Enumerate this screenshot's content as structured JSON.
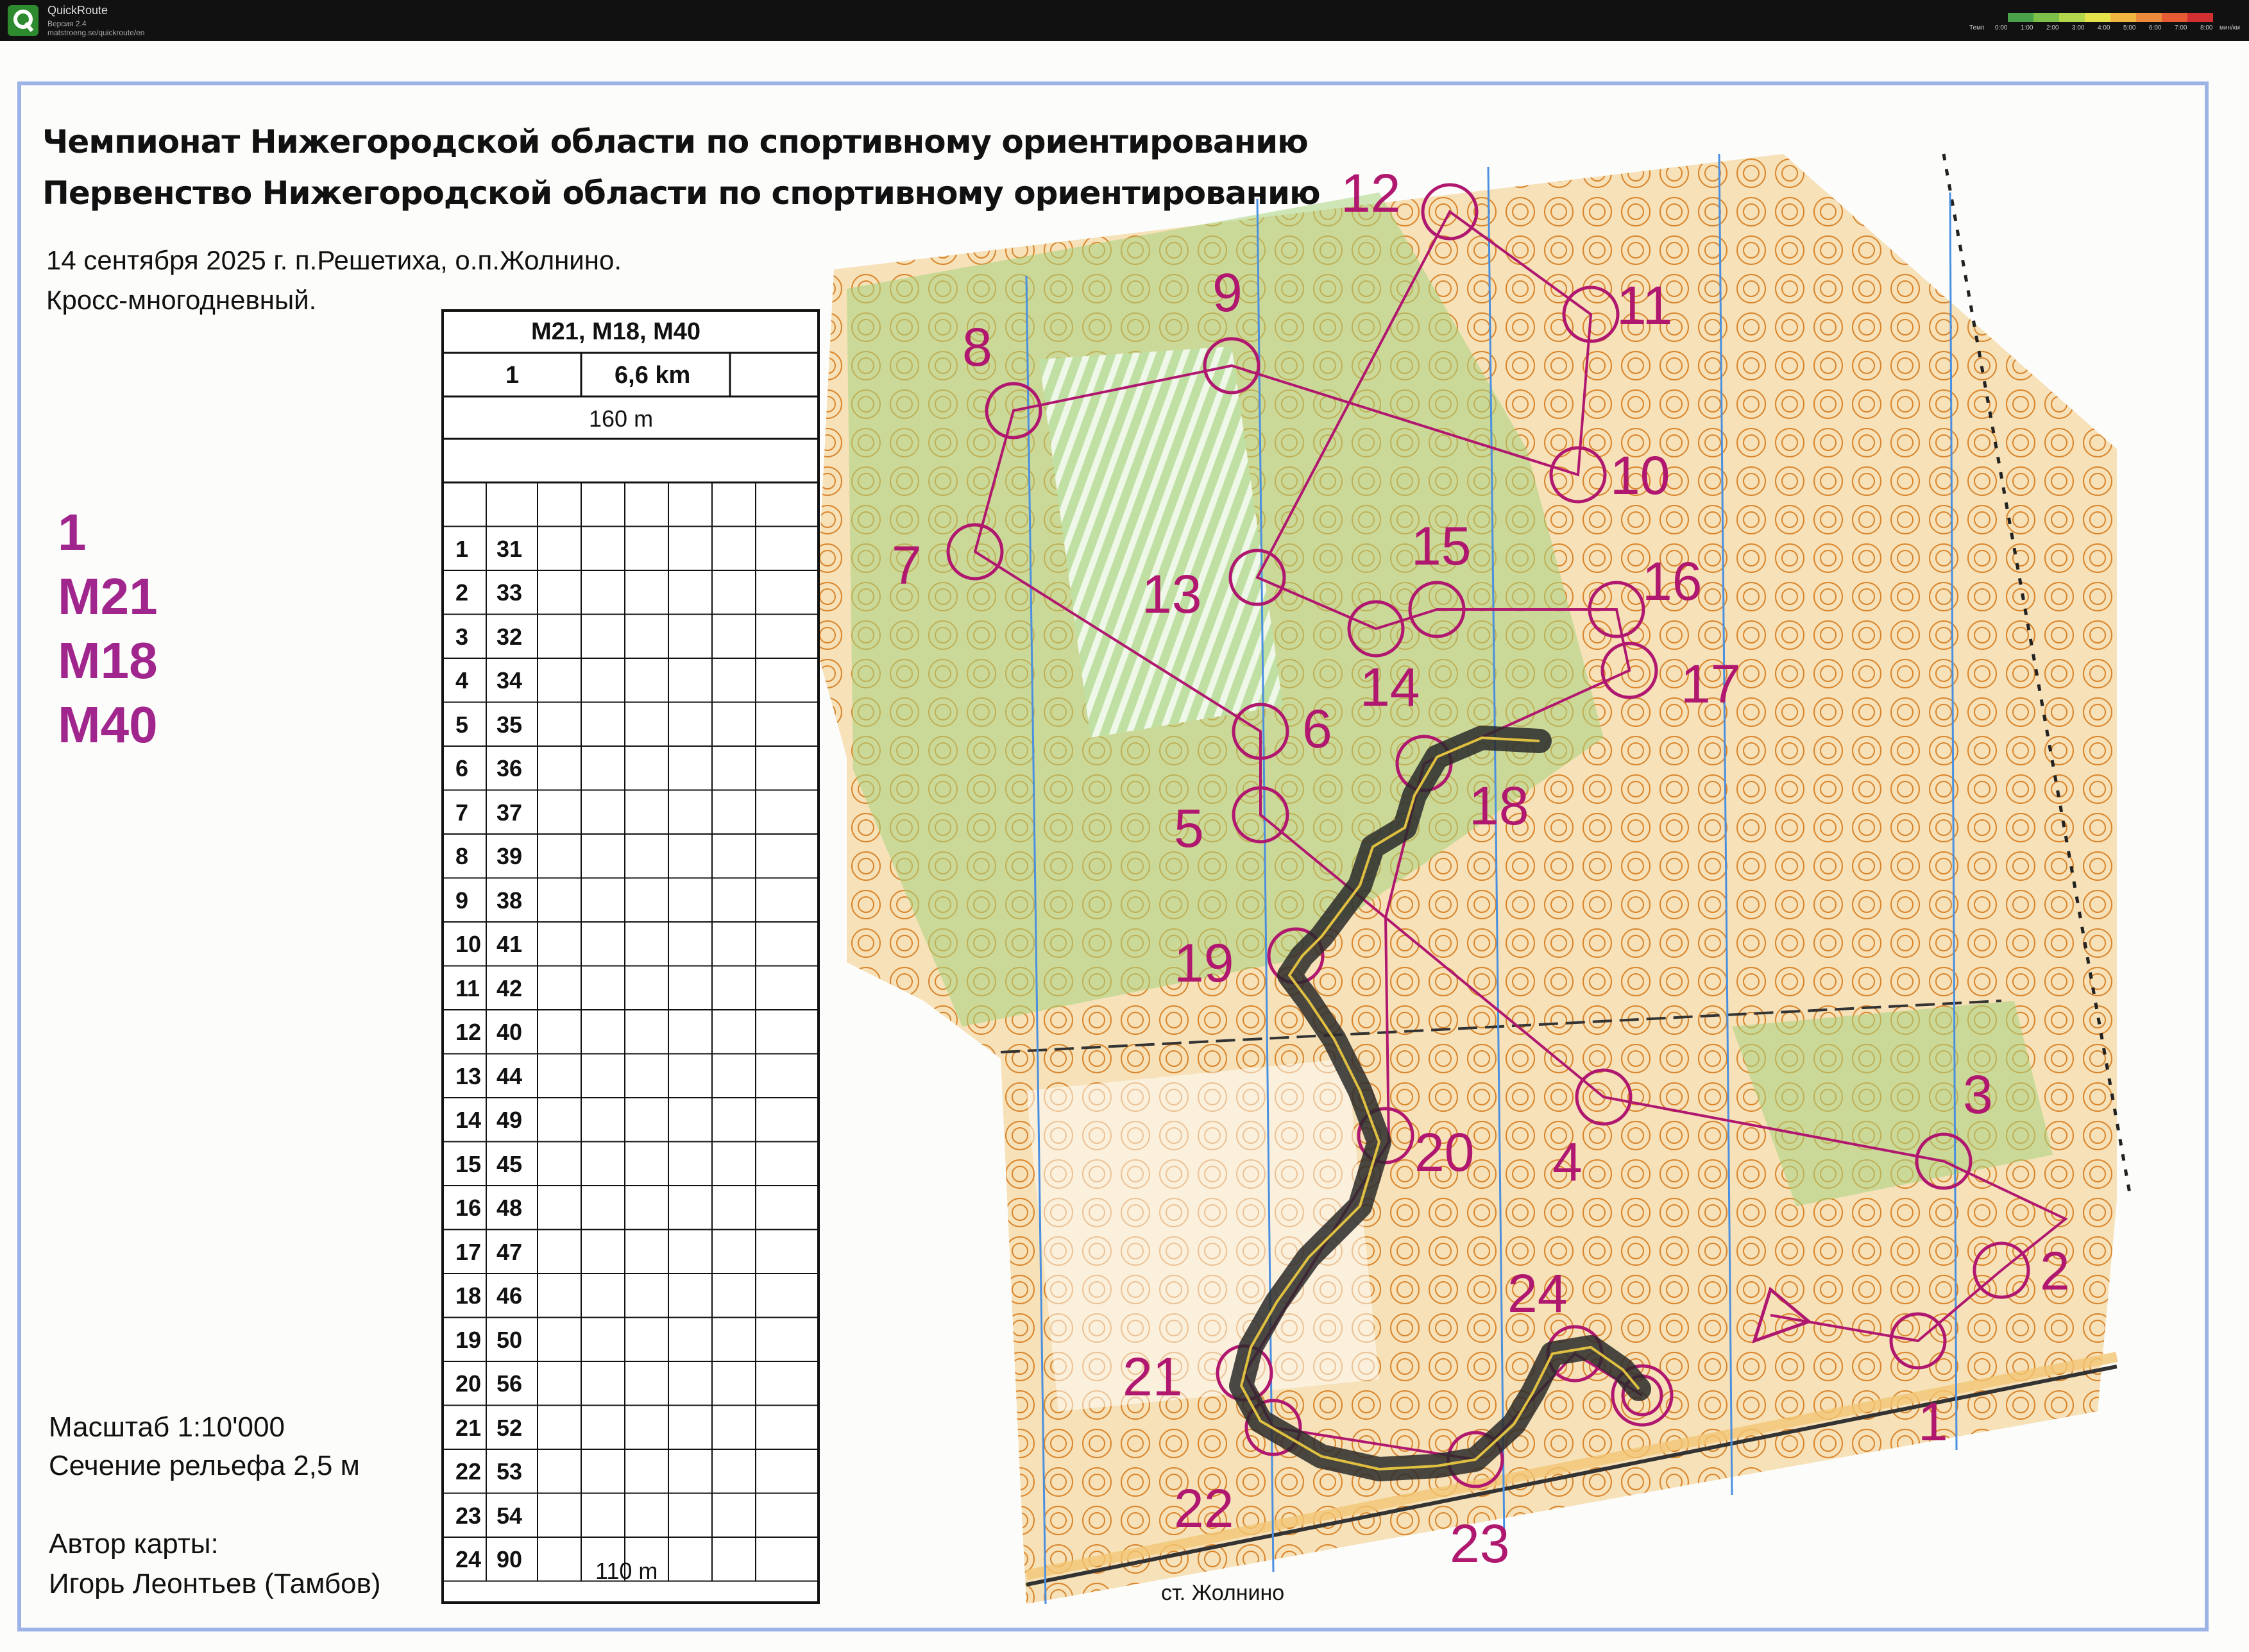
{
  "app": {
    "title": "QuickRoute",
    "version": "Версия 2.4",
    "url": "matstroeng.se/quickroute/en",
    "logo_icon": "quickroute-q-icon",
    "pace_label": "Темп",
    "pace_ticks": [
      "0:00",
      "1:00",
      "2:00",
      "3:00",
      "4:00",
      "5:00",
      "6:00",
      "7:00",
      "8:00",
      "мин/км"
    ]
  },
  "map": {
    "title_lines": [
      "Чемпионат Нижегородской области по спортивному ориентированию",
      "Первенство Нижегородской области по спортивному ориентированию"
    ],
    "event_lines": [
      "14 сентября 2025 г. п.Решетиха, о.п.Жолнино.",
      "Кросс-многодневный."
    ],
    "course": {
      "number": "1",
      "classes": [
        "M21",
        "M18",
        "M40"
      ]
    },
    "scale": "Масштаб 1:10'000",
    "contour": "Сечение рельефа 2,5 м",
    "author_label": "Автор карты:",
    "author_name": "Игорь Леонтьев (Тамбов)",
    "station": "ст. Жолнино",
    "colors": {
      "course": "#b0176f",
      "route": "#333333",
      "route_core": "#e0c040",
      "vegetation": "#9ccb72",
      "open": "#f2b85a"
    }
  },
  "description": {
    "header": "M21, M18, M40",
    "course_number": "1",
    "length": "6,6 km",
    "start_dist": "160 m",
    "finish_dist": "110 m",
    "controls": [
      {
        "n": "1",
        "code": "31"
      },
      {
        "n": "2",
        "code": "33"
      },
      {
        "n": "3",
        "code": "32"
      },
      {
        "n": "4",
        "code": "34"
      },
      {
        "n": "5",
        "code": "35"
      },
      {
        "n": "6",
        "code": "36"
      },
      {
        "n": "7",
        "code": "37"
      },
      {
        "n": "8",
        "code": "39"
      },
      {
        "n": "9",
        "code": "38"
      },
      {
        "n": "10",
        "code": "41"
      },
      {
        "n": "11",
        "code": "42"
      },
      {
        "n": "12",
        "code": "40"
      },
      {
        "n": "13",
        "code": "44"
      },
      {
        "n": "14",
        "code": "49"
      },
      {
        "n": "15",
        "code": "45"
      },
      {
        "n": "16",
        "code": "48"
      },
      {
        "n": "17",
        "code": "47"
      },
      {
        "n": "18",
        "code": "46"
      },
      {
        "n": "19",
        "code": "50"
      },
      {
        "n": "20",
        "code": "56"
      },
      {
        "n": "21",
        "code": "52"
      },
      {
        "n": "22",
        "code": "53"
      },
      {
        "n": "23",
        "code": "54"
      },
      {
        "n": "24",
        "code": "90"
      }
    ]
  }
}
